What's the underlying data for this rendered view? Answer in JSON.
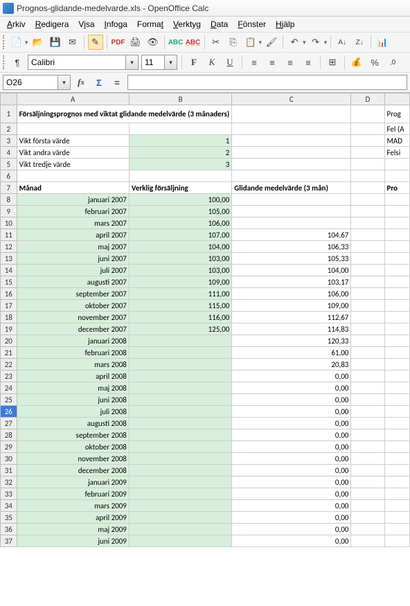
{
  "title": "Prognos-glidande-medelvarde.xls - OpenOffice Calc",
  "menu": {
    "arkiv": "Arkiv",
    "redigera": "Redigera",
    "visa": "Visa",
    "infoga": "Infoga",
    "format": "Format",
    "verktyg": "Verktyg",
    "data": "Data",
    "fonster": "Fönster",
    "hjalp": "Hjälp"
  },
  "font": {
    "name": "Calibri",
    "size": "11"
  },
  "namebox": "O26",
  "formula": "",
  "cols": [
    "A",
    "B",
    "C",
    "D"
  ],
  "row1": {
    "a": "Försäljningsprognos med viktat glidande medelvärde (3 månaders)",
    "e": "Prog"
  },
  "row2": {
    "e": "Fel (A"
  },
  "row3": {
    "a": "Vikt första värde",
    "b": "1",
    "e": "MAD"
  },
  "row4": {
    "a": "Vikt andra värde",
    "b": "2",
    "e": "Felsi"
  },
  "row5": {
    "a": "Vikt tredje värde",
    "b": "3"
  },
  "row7": {
    "a": "Månad",
    "b": "Verklig försäljning",
    "c": "Glidande medelvärde (3 mån)",
    "e": "Pro"
  },
  "rows": [
    {
      "n": 8,
      "a": "januari 2007",
      "b": "100,00",
      "c": ""
    },
    {
      "n": 9,
      "a": "februari 2007",
      "b": "105,00",
      "c": ""
    },
    {
      "n": 10,
      "a": "mars 2007",
      "b": "106,00",
      "c": ""
    },
    {
      "n": 11,
      "a": "april 2007",
      "b": "107,00",
      "c": "104,67"
    },
    {
      "n": 12,
      "a": "maj 2007",
      "b": "104,00",
      "c": "106,33"
    },
    {
      "n": 13,
      "a": "juni 2007",
      "b": "103,00",
      "c": "105,33"
    },
    {
      "n": 14,
      "a": "juli 2007",
      "b": "103,00",
      "c": "104,00"
    },
    {
      "n": 15,
      "a": "augusti 2007",
      "b": "109,00",
      "c": "103,17"
    },
    {
      "n": 16,
      "a": "september 2007",
      "b": "111,00",
      "c": "106,00"
    },
    {
      "n": 17,
      "a": "oktober 2007",
      "b": "115,00",
      "c": "109,00"
    },
    {
      "n": 18,
      "a": "november 2007",
      "b": "116,00",
      "c": "112,67"
    },
    {
      "n": 19,
      "a": "december 2007",
      "b": "125,00",
      "c": "114,83"
    },
    {
      "n": 20,
      "a": "januari 2008",
      "b": "",
      "c": "120,33"
    },
    {
      "n": 21,
      "a": "februari 2008",
      "b": "",
      "c": "61,00"
    },
    {
      "n": 22,
      "a": "mars 2008",
      "b": "",
      "c": "20,83"
    },
    {
      "n": 23,
      "a": "april 2008",
      "b": "",
      "c": "0,00"
    },
    {
      "n": 24,
      "a": "maj 2008",
      "b": "",
      "c": "0,00"
    },
    {
      "n": 25,
      "a": "juni 2008",
      "b": "",
      "c": "0,00"
    },
    {
      "n": 26,
      "a": "juli 2008",
      "b": "",
      "c": "0,00"
    },
    {
      "n": 27,
      "a": "augusti 2008",
      "b": "",
      "c": "0,00"
    },
    {
      "n": 28,
      "a": "september 2008",
      "b": "",
      "c": "0,00"
    },
    {
      "n": 29,
      "a": "oktober 2008",
      "b": "",
      "c": "0,00"
    },
    {
      "n": 30,
      "a": "november 2008",
      "b": "",
      "c": "0,00"
    },
    {
      "n": 31,
      "a": "december 2008",
      "b": "",
      "c": "0,00"
    },
    {
      "n": 32,
      "a": "januari 2009",
      "b": "",
      "c": "0,00"
    },
    {
      "n": 33,
      "a": "februari 2009",
      "b": "",
      "c": "0,00"
    },
    {
      "n": 34,
      "a": "mars 2009",
      "b": "",
      "c": "0,00"
    },
    {
      "n": 35,
      "a": "april 2009",
      "b": "",
      "c": "0,00"
    },
    {
      "n": 36,
      "a": "maj 2009",
      "b": "",
      "c": "0,00"
    },
    {
      "n": 37,
      "a": "juni 2009",
      "b": "",
      "c": "0,00"
    }
  ]
}
